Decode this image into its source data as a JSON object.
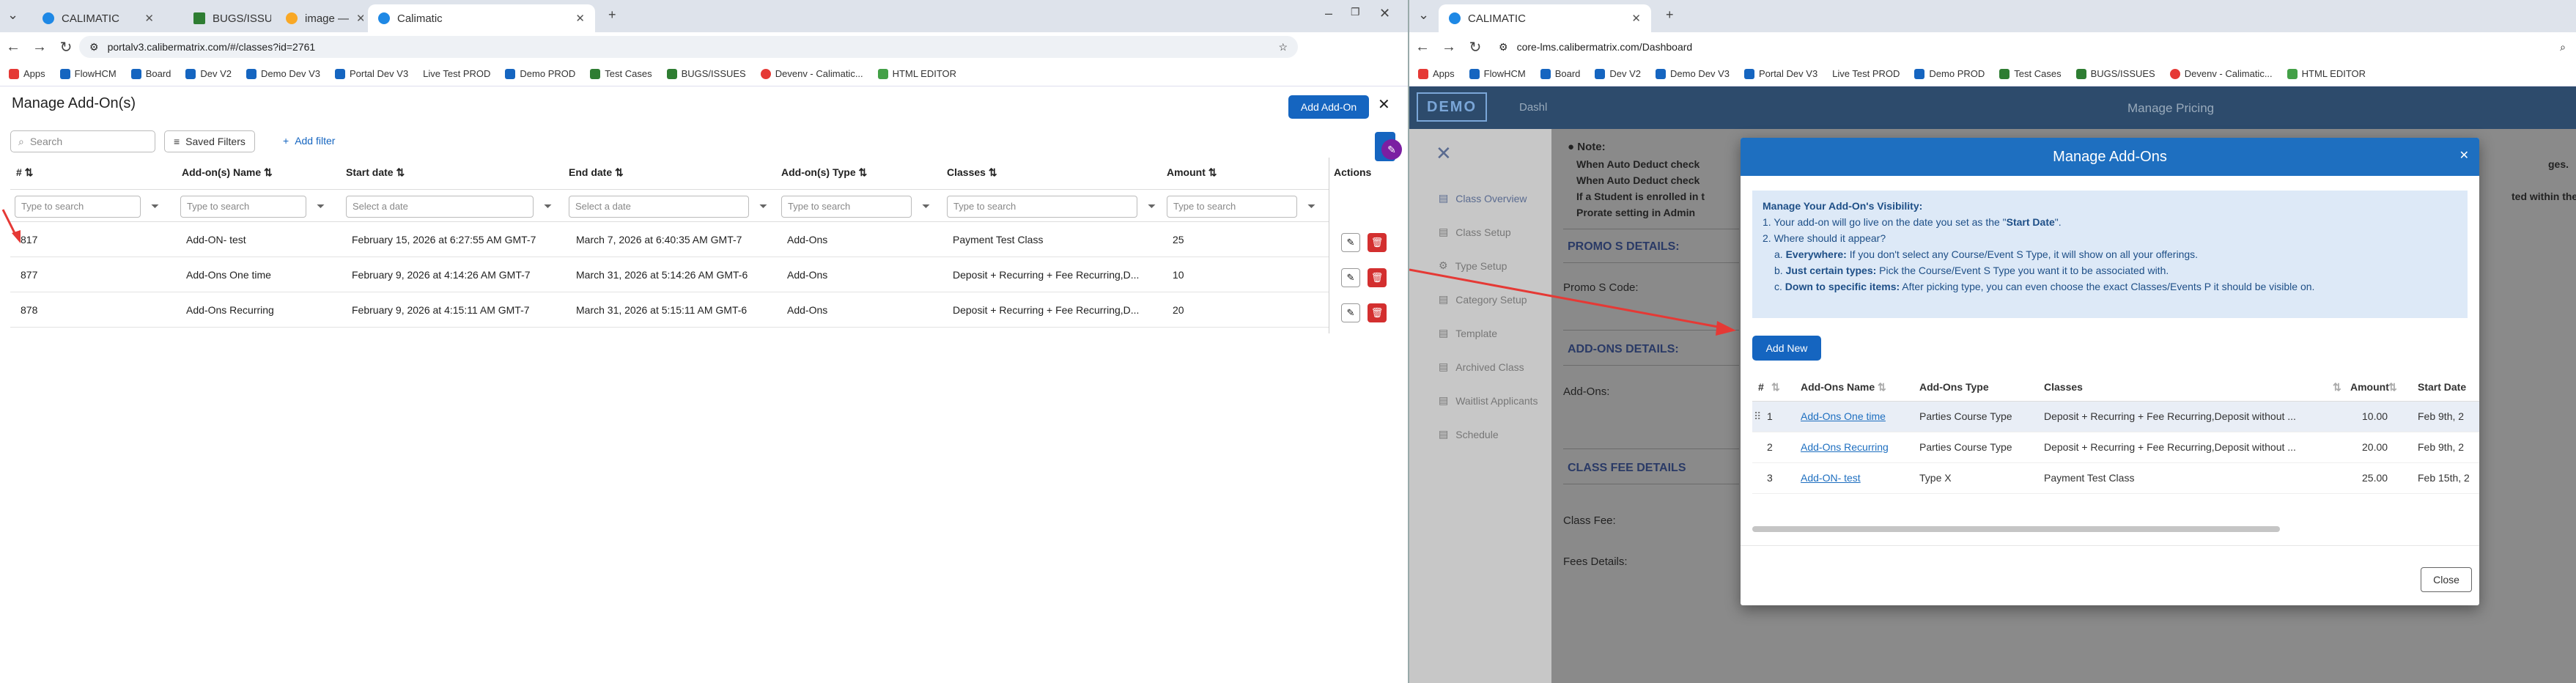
{
  "left": {
    "tabs": [
      {
        "label": "CALIMATIC",
        "color": "#1e88e5"
      },
      {
        "label": "BUGS/ISSU",
        "color": "#2e7d32"
      },
      {
        "label": "image —",
        "color": "#f9a825"
      },
      {
        "label": "Calimatic",
        "color": "#1e88e5"
      }
    ],
    "url": "portalv3.calibermatrix.com/#/classes?id=2761",
    "bookmarks": [
      "Apps",
      "FlowHCM",
      "Board",
      "Dev V2",
      "Demo Dev V3",
      "Portal Dev V3",
      "Live Test PROD",
      "Demo PROD",
      "Test Cases",
      "BUGS/ISSUES",
      "Devenv - Calimatic...",
      "HTML EDITOR"
    ],
    "title": "Manage Add-On(s)",
    "add_button": "Add Add-On",
    "search_placeholder": "Search",
    "saved_filters": "Saved Filters",
    "add_filter": "Add filter",
    "columns": [
      "#",
      "Add-on(s) Name",
      "Start date",
      "End date",
      "Add-on(s) Type",
      "Classes",
      "Amount",
      "Actions"
    ],
    "filters": [
      "Type to search",
      "Type to search",
      "Select a date",
      "Select a date",
      "Type to search",
      "Type to search",
      "Type to search"
    ],
    "rows": [
      {
        "id": "817",
        "name": "Add-ON- test",
        "start": "February 15, 2026 at 6:27:55 AM GMT-7",
        "end": "March 7, 2026 at 6:40:35 AM GMT-7",
        "type": "Add-Ons",
        "classes": "Payment Test Class",
        "amount": "25"
      },
      {
        "id": "877",
        "name": "Add-Ons One time",
        "start": "February 9, 2026 at 4:14:26 AM GMT-7",
        "end": "March 31, 2026 at 5:14:26 AM GMT-6",
        "type": "Add-Ons",
        "classes": "Deposit + Recurring + Fee Recurring,D...",
        "amount": "10"
      },
      {
        "id": "878",
        "name": "Add-Ons Recurring",
        "start": "February 9, 2026 at 4:15:11 AM GMT-7",
        "end": "March 31, 2026 at 5:15:11 AM GMT-6",
        "type": "Add-Ons",
        "classes": "Deposit + Recurring + Fee Recurring,D...",
        "amount": "20"
      }
    ]
  },
  "right": {
    "tab": "CALIMATIC",
    "url": "core-lms.calibermatrix.com/Dashboard",
    "bookmarks": [
      "Apps",
      "FlowHCM",
      "Board",
      "Dev V2",
      "Demo Dev V3",
      "Portal Dev V3",
      "Live Test PROD",
      "Demo PROD",
      "Test Cases",
      "BUGS/ISSUES",
      "Devenv - Calimatic...",
      "HTML EDITOR"
    ],
    "logo": "DEMO",
    "top_trunc": "Dashl",
    "top_title": "Manage Pricing",
    "sidebar": [
      "Class Overview",
      "Class Setup",
      "Type Setup",
      "Category Setup",
      "Template",
      "Archived Class",
      "Waitlist Applicants",
      "Schedule"
    ],
    "note_title": "Note:",
    "notes": [
      "When Auto Deduct check",
      "When Auto Deduct check",
      "If a Student is enrolled in t",
      "Prorate setting in Admin"
    ],
    "right_fragments": [
      "ges.",
      "ted within the firs"
    ],
    "promo_title": "PROMO S DETAILS:",
    "promo_label": "Promo S Code:",
    "addons_title": "ADD-ONS DETAILS:",
    "addons_label": "Add-Ons:",
    "classfee_title": "CLASS FEE DETAILS",
    "class_fee_label": "Class Fee:",
    "fees_details_label": "Fees Details:",
    "modal": {
      "title": "Manage Add-Ons",
      "info_title": "Manage Your Add-On's Visibility:",
      "info_line1_a": "1. Your add-on will go live on the date you set as the \"",
      "info_line1_b": "Start Date",
      "info_line1_c": "\".",
      "info_line2": "2. Where should it appear?",
      "info_a_b": "Everywhere:",
      "info_a": " If you don't select any Course/Event S Type, it will show on all your offerings.",
      "info_b_b": "Just certain types:",
      "info_b": " Pick the Course/Event S Type you want it to be associated with.",
      "info_c_b": "Down to specific items:",
      "info_c": " After picking type, you can even choose the exact Classes/Events P it should be visible on.",
      "add_new": "Add New",
      "columns": [
        "#",
        "Add-Ons Name",
        "Add-Ons Type",
        "Classes",
        "Amount",
        "Start Date"
      ],
      "rows": [
        {
          "n": "1",
          "name": "Add-Ons One time",
          "type": "Parties Course Type",
          "classes": "Deposit + Recurring + Fee Recurring,Deposit without ...",
          "amount": "10.00",
          "start": "Feb 9th, 2"
        },
        {
          "n": "2",
          "name": "Add-Ons Recurring",
          "type": "Parties Course Type",
          "classes": "Deposit + Recurring + Fee Recurring,Deposit without ...",
          "amount": "20.00",
          "start": "Feb 9th, 2"
        },
        {
          "n": "3",
          "name": "Add-ON- test",
          "type": "Type X",
          "classes": "Payment Test Class",
          "amount": "25.00",
          "start": "Feb 15th, 2"
        }
      ],
      "close": "Close"
    }
  },
  "colors": {
    "primary": "#1565c0",
    "modal_header": "#1e6fc0",
    "delete": "#d32f2f",
    "arrow": "#e53935"
  }
}
